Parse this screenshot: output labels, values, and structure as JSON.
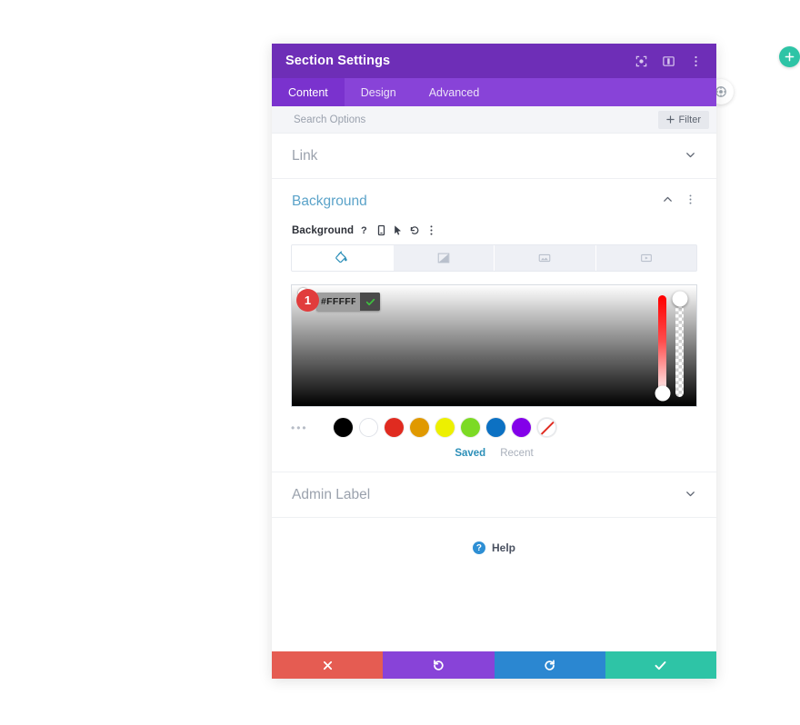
{
  "page": {
    "background": "#ffffff",
    "add_button_icon": "plus-icon",
    "side_button_icon": "settings-circle-icon"
  },
  "modal": {
    "title": "Section Settings",
    "header_icons": [
      {
        "name": "focus-target-icon",
        "label": "Focus"
      },
      {
        "name": "split-view-icon",
        "label": "Split View"
      },
      {
        "name": "more-vertical-icon",
        "label": "More Options"
      }
    ],
    "tabs": [
      {
        "label": "Content",
        "active": true
      },
      {
        "label": "Design",
        "active": false
      },
      {
        "label": "Advanced",
        "active": false
      }
    ],
    "search": {
      "placeholder": "Search Options",
      "value": "",
      "filter_label": "Filter",
      "filter_icon": "plus-icon"
    },
    "sections": [
      {
        "label": "Link",
        "state": "collapsed",
        "chevron": "chevron-down-icon"
      },
      {
        "label": "Background",
        "state": "expanded",
        "chevron": "chevron-up-icon"
      },
      {
        "label": "Admin Label",
        "state": "collapsed",
        "chevron": "chevron-down-icon"
      }
    ],
    "background_section": {
      "title": "Background",
      "accent_color": "#5BA3C9",
      "field_label": "Background",
      "field_icons": [
        {
          "name": "help-question-icon",
          "glyph": "?"
        },
        {
          "name": "responsive-mobile-icon",
          "glyph": "mobile"
        },
        {
          "name": "hover-cursor-icon",
          "glyph": "cursor"
        },
        {
          "name": "reset-undo-icon",
          "glyph": "undo"
        },
        {
          "name": "more-vertical-icon",
          "glyph": "dots"
        }
      ],
      "type_tabs": [
        {
          "name": "background-color-tab",
          "icon": "paint-bucket-icon",
          "active": true
        },
        {
          "name": "background-gradient-tab",
          "icon": "gradient-icon",
          "active": false
        },
        {
          "name": "background-image-tab",
          "icon": "image-icon",
          "active": false
        },
        {
          "name": "background-video-tab",
          "icon": "video-icon",
          "active": false
        }
      ],
      "color_picker": {
        "hex_value": "#FFFFFF",
        "confirm_icon": "checkmark-icon",
        "step_badge": "1",
        "badge_color": "#E13C3C",
        "hue_handle_position": "bottom",
        "alpha_handle_position": "top"
      },
      "swatches": [
        {
          "name": "swatch-black",
          "color": "#000000"
        },
        {
          "name": "swatch-white",
          "color": "#FFFFFF"
        },
        {
          "name": "swatch-red",
          "color": "#E02B20"
        },
        {
          "name": "swatch-orange",
          "color": "#E09900"
        },
        {
          "name": "swatch-yellow",
          "color": "#EDF000"
        },
        {
          "name": "swatch-green",
          "color": "#7CDA24"
        },
        {
          "name": "swatch-blue",
          "color": "#0C71C3"
        },
        {
          "name": "swatch-purple",
          "color": "#8300E9"
        },
        {
          "name": "swatch-transparent",
          "color": "transparent"
        }
      ],
      "more_swatches_icon": "ellipsis-icon",
      "palette_tabs": [
        {
          "label": "Saved",
          "active": true
        },
        {
          "label": "Recent",
          "active": false
        }
      ]
    },
    "help": {
      "label": "Help",
      "icon": "help-circle-icon"
    },
    "footer_buttons": [
      {
        "name": "cancel-button",
        "icon": "close-x-icon",
        "color": "#E55C52"
      },
      {
        "name": "undo-button",
        "icon": "undo-icon",
        "color": "#8843D8"
      },
      {
        "name": "redo-button",
        "icon": "redo-icon",
        "color": "#2B87D1"
      },
      {
        "name": "save-button",
        "icon": "checkmark-icon",
        "color": "#2EC4A6"
      }
    ]
  }
}
